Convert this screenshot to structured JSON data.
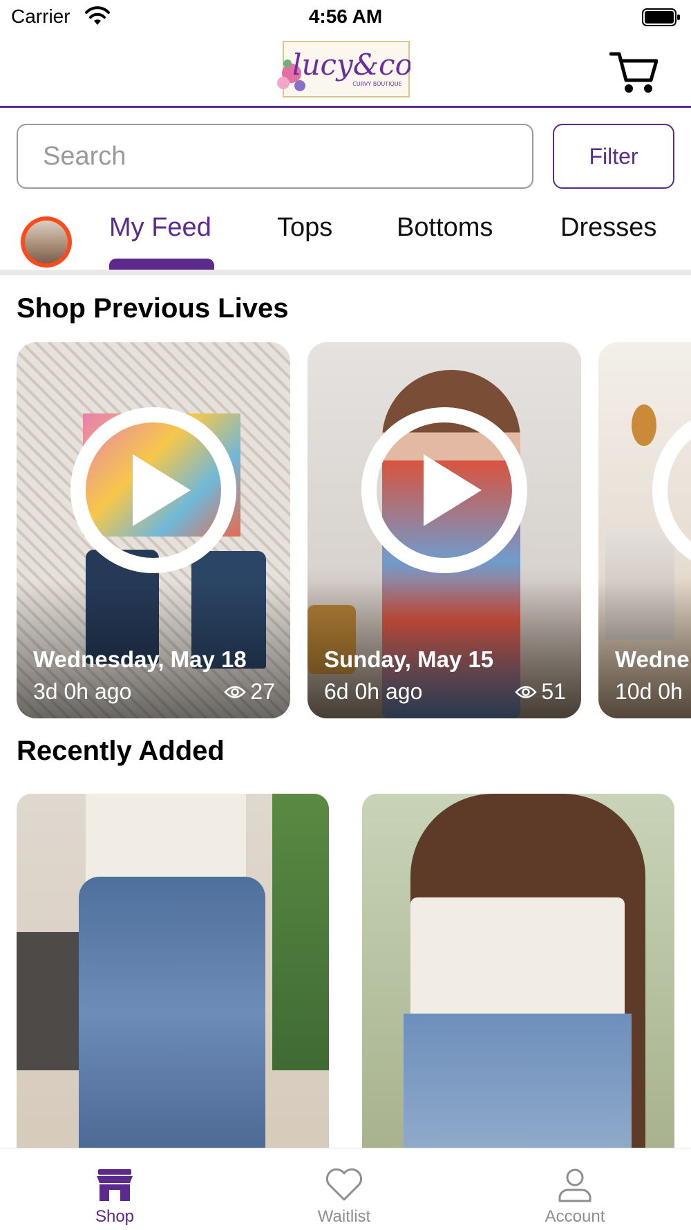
{
  "status_bar": {
    "carrier": "Carrier",
    "time": "4:56 AM"
  },
  "header": {
    "logo_text": "lucy&co",
    "logo_subtext": "CURVY BOUTIQUE",
    "cart_icon": "cart-icon"
  },
  "search": {
    "placeholder": "Search",
    "value": ""
  },
  "filter_label": "Filter",
  "tabs": [
    {
      "label": "My Feed",
      "active": true
    },
    {
      "label": "Tops",
      "active": false
    },
    {
      "label": "Bottoms",
      "active": false
    },
    {
      "label": "Dresses",
      "active": false
    }
  ],
  "sections": {
    "previous_lives_title": "Shop Previous Lives",
    "recently_added_title": "Recently Added"
  },
  "lives": [
    {
      "date": "Wednesday, May 18",
      "ago": "3d 0h ago",
      "views": "27"
    },
    {
      "date": "Sunday, May 15",
      "ago": "6d 0h ago",
      "views": "51"
    },
    {
      "date": "Wedne",
      "ago": "10d 0h",
      "views": ""
    }
  ],
  "tab_bar": [
    {
      "label": "Shop",
      "icon": "shop-icon",
      "active": true
    },
    {
      "label": "Waitlist",
      "icon": "heart-icon",
      "active": false
    },
    {
      "label": "Account",
      "icon": "person-icon",
      "active": false
    }
  ],
  "colors": {
    "accent": "#5b2a8c",
    "avatar_ring": "#ff4a1c",
    "text_primary": "#111111",
    "text_muted": "#8e8e8e"
  }
}
